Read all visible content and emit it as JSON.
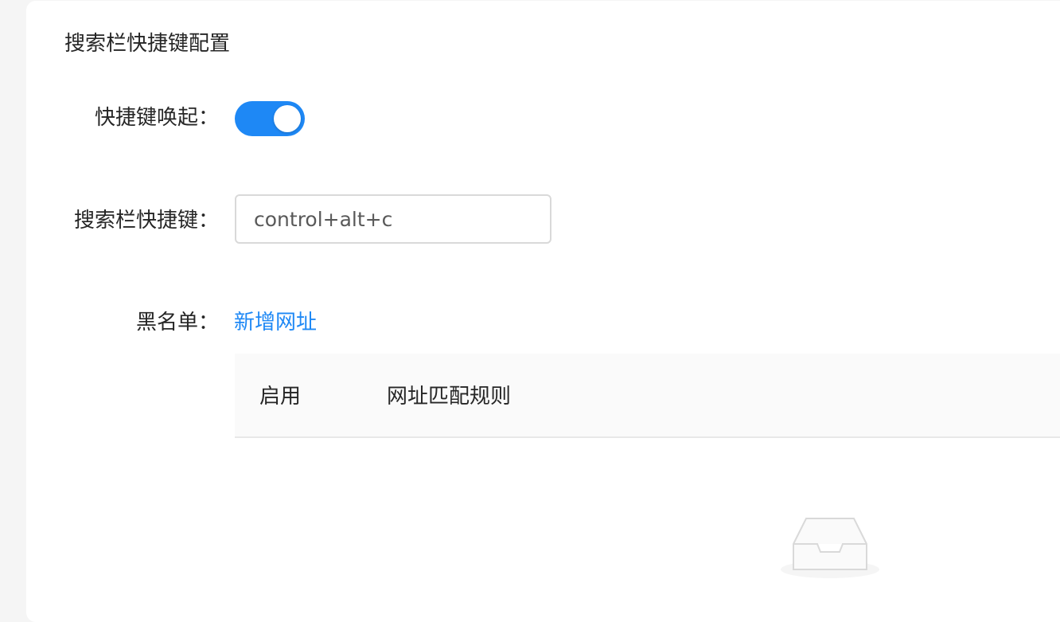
{
  "card": {
    "title": "搜索栏快捷键配置"
  },
  "form": {
    "toggle_label": "快捷键唤起：",
    "toggle_on": true,
    "hotkey_label": "搜索栏快捷键：",
    "hotkey_value": "control+alt+c",
    "blacklist_label": "黑名单：",
    "add_url_link": "新增网址"
  },
  "table": {
    "columns": [
      "启用",
      "网址匹配规则"
    ],
    "rows": []
  },
  "colors": {
    "accent": "#1e88f5",
    "header_bg": "#fafafa",
    "border": "#d9d9d9"
  },
  "icons": {
    "empty": "inbox-empty-icon"
  }
}
